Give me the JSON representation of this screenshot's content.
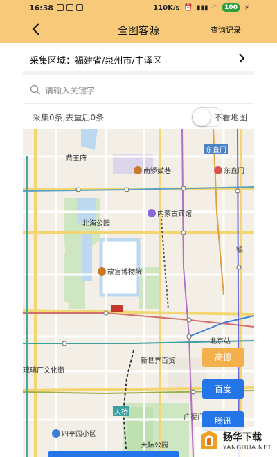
{
  "status_bar": {
    "time": "16:38",
    "network_speed": "110K/s",
    "battery": "100"
  },
  "header": {
    "title": "全图客源",
    "query_label": "查询记录"
  },
  "region": {
    "label": "采集区域：福建省/泉州市/丰泽区"
  },
  "search": {
    "placeholder": "请输入关键字",
    "value": ""
  },
  "stats": {
    "count_text": "采集0条,去重后0条",
    "hide_map_label": "不看地图",
    "toggle_on": false
  },
  "map": {
    "labels": {
      "gongwangfu": "恭王府",
      "nanluoguxiang": "南锣鼓巷",
      "dongzhimen_station": "东直门",
      "dongzhimen": "东直门",
      "beihai": "北海公园",
      "neimenggu": "内蒙古宾馆",
      "gugong": "故宫博物院",
      "yin": "银",
      "beijingzhan": "北京站",
      "xinshijie": "新世界百货",
      "liulichang": "琉璃厂文化街",
      "tianqiao": "天桥",
      "sipingyuan": "四平园小区",
      "tiantan": "天坛公园",
      "guangqu": "广渠门"
    }
  },
  "map_buttons": {
    "gaode": "高德",
    "baidu": "百度",
    "tencent": "腾讯"
  },
  "watermark": {
    "name": "扬华下载",
    "domain": "YANGHUA.NET"
  },
  "colors": {
    "header_bg": "#f7c978",
    "primary_blue": "#2476e8",
    "gaode_orange": "#f5b04e"
  }
}
